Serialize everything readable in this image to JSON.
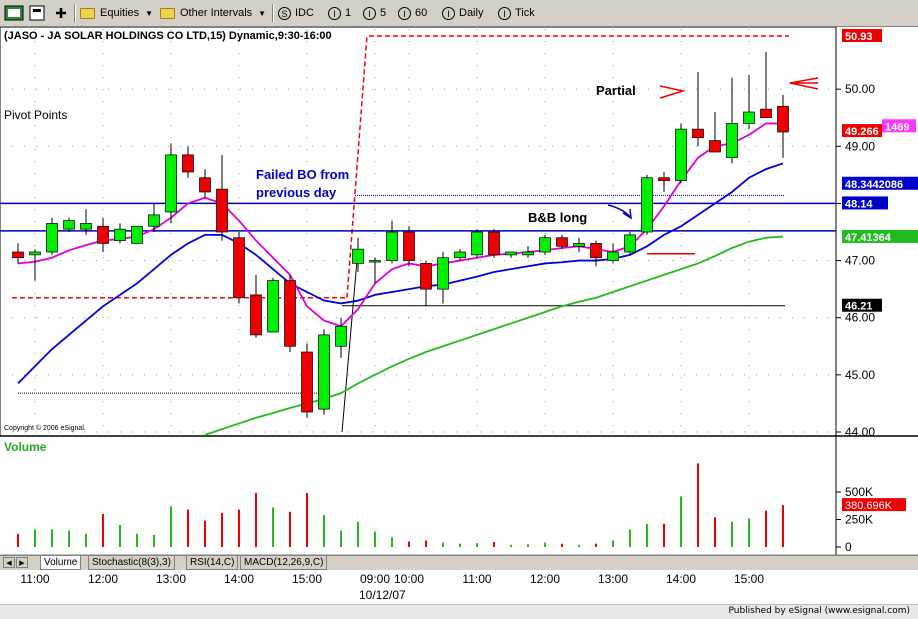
{
  "toolbar": {
    "equities_label": "Equities",
    "other_intervals_label": "Other Intervals",
    "idc_label": "IDC",
    "interval_1": "1",
    "interval_5": "5",
    "interval_60": "60",
    "daily_label": "Daily",
    "tick_label": "Tick",
    "idc_icon": "S",
    "interval_icon": "I"
  },
  "tabs": [
    "Volume",
    "Stochastic(8(3),3)",
    "RSI(14,C)",
    "MACD(12,26,9,C)"
  ],
  "footer": {
    "published": "Published by eSignal (www.esignal.com)"
  },
  "colors": {
    "up": "#00ee00",
    "down": "#ee0000",
    "ma_fast": "#dd00dd",
    "ma_mid": "#0000dd",
    "ma_slow": "#22bb22",
    "level": "#0000aa",
    "pivot": "#ff0000"
  },
  "chart_data": {
    "type": "candlestick",
    "title": "(JASO - JA SOLAR HOLDINGS CO LTD,15) Dynamic,9:30-16:00",
    "copyright": "Copyright © 2006 eSignal.",
    "pivot_label": "Pivot Points",
    "volume_label": "Volume",
    "date_label": "10/12/07",
    "ylim": [
      44.0,
      51.0
    ],
    "y_ticks": [
      44.0,
      45.0,
      46.0,
      47.0,
      48.0,
      49.0,
      50.0
    ],
    "volume_ticks": [
      {
        "label": "500K",
        "value": 500000
      },
      {
        "label": "250K",
        "value": 250000
      },
      {
        "label": "0",
        "value": 0
      }
    ],
    "volume_max": 800000,
    "x_labels": [
      {
        "label": "11:00",
        "bar": 1
      },
      {
        "label": "12:00",
        "bar": 5
      },
      {
        "label": "13:00",
        "bar": 9
      },
      {
        "label": "14:00",
        "bar": 13
      },
      {
        "label": "15:00",
        "bar": 17
      },
      {
        "label": "09:00",
        "bar": 21
      },
      {
        "label": "10:00",
        "bar": 23
      },
      {
        "label": "11:00",
        "bar": 27
      },
      {
        "label": "12:00",
        "bar": 31
      },
      {
        "label": "13:00",
        "bar": 35
      },
      {
        "label": "14:00",
        "bar": 39
      },
      {
        "label": "15:00",
        "bar": 43
      }
    ],
    "candles": [
      {
        "o": 47.15,
        "h": 47.3,
        "l": 46.95,
        "c": 47.05,
        "v": 120000
      },
      {
        "o": 47.1,
        "h": 47.2,
        "l": 46.65,
        "c": 47.15,
        "v": 160000
      },
      {
        "o": 47.15,
        "h": 47.75,
        "l": 47.1,
        "c": 47.65,
        "v": 160000
      },
      {
        "o": 47.55,
        "h": 47.75,
        "l": 47.5,
        "c": 47.7,
        "v": 150000
      },
      {
        "o": 47.55,
        "h": 47.9,
        "l": 47.45,
        "c": 47.65,
        "v": 120000
      },
      {
        "o": 47.6,
        "h": 47.75,
        "l": 47.15,
        "c": 47.3,
        "v": 300000
      },
      {
        "o": 47.35,
        "h": 47.65,
        "l": 47.3,
        "c": 47.55,
        "v": 200000
      },
      {
        "o": 47.3,
        "h": 47.6,
        "l": 47.3,
        "c": 47.6,
        "v": 120000
      },
      {
        "o": 47.6,
        "h": 48.0,
        "l": 47.5,
        "c": 47.8,
        "v": 110000
      },
      {
        "o": 47.85,
        "h": 49.05,
        "l": 47.65,
        "c": 48.85,
        "v": 370000
      },
      {
        "o": 48.85,
        "h": 49.0,
        "l": 48.45,
        "c": 48.55,
        "v": 340000
      },
      {
        "o": 48.45,
        "h": 48.6,
        "l": 48.1,
        "c": 48.2,
        "v": 240000
      },
      {
        "o": 48.25,
        "h": 48.85,
        "l": 47.35,
        "c": 47.5,
        "v": 310000
      },
      {
        "o": 47.4,
        "h": 47.5,
        "l": 46.25,
        "c": 46.35,
        "v": 340000
      },
      {
        "o": 46.4,
        "h": 46.75,
        "l": 45.65,
        "c": 45.7,
        "v": 490000
      },
      {
        "o": 45.75,
        "h": 46.7,
        "l": 45.75,
        "c": 46.65,
        "v": 360000
      },
      {
        "o": 46.65,
        "h": 46.75,
        "l": 45.4,
        "c": 45.5,
        "v": 320000
      },
      {
        "o": 45.4,
        "h": 45.55,
        "l": 44.25,
        "c": 44.35,
        "v": 490000
      },
      {
        "o": 44.4,
        "h": 45.8,
        "l": 44.3,
        "c": 45.7,
        "v": 290000
      },
      {
        "o": 45.5,
        "h": 46.0,
        "l": 45.3,
        "c": 45.85,
        "v": 150000
      },
      {
        "o": 46.95,
        "h": 47.4,
        "l": 46.8,
        "c": 47.2,
        "v": 230000
      },
      {
        "o": 47.0,
        "h": 47.05,
        "l": 46.6,
        "c": 47.0,
        "v": 140000
      },
      {
        "o": 47.0,
        "h": 47.7,
        "l": 46.95,
        "c": 47.5,
        "v": 90000
      },
      {
        "o": 47.5,
        "h": 47.6,
        "l": 46.9,
        "c": 47.0,
        "v": 50000
      },
      {
        "o": 46.95,
        "h": 47.0,
        "l": 46.2,
        "c": 46.5,
        "v": 60000
      },
      {
        "o": 46.5,
        "h": 47.15,
        "l": 46.25,
        "c": 47.05,
        "v": 40000
      },
      {
        "o": 47.05,
        "h": 47.2,
        "l": 47.0,
        "c": 47.15,
        "v": 30000
      },
      {
        "o": 47.1,
        "h": 47.55,
        "l": 47.05,
        "c": 47.5,
        "v": 35000
      },
      {
        "o": 47.5,
        "h": 47.55,
        "l": 47.05,
        "c": 47.1,
        "v": 45000
      },
      {
        "o": 47.1,
        "h": 47.15,
        "l": 47.05,
        "c": 47.15,
        "v": 20000
      },
      {
        "o": 47.1,
        "h": 47.25,
        "l": 47.05,
        "c": 47.15,
        "v": 25000
      },
      {
        "o": 47.15,
        "h": 47.45,
        "l": 47.1,
        "c": 47.4,
        "v": 40000
      },
      {
        "o": 47.4,
        "h": 47.45,
        "l": 47.2,
        "c": 47.25,
        "v": 30000
      },
      {
        "o": 47.25,
        "h": 47.4,
        "l": 47.15,
        "c": 47.3,
        "v": 20000
      },
      {
        "o": 47.3,
        "h": 47.35,
        "l": 46.9,
        "c": 47.05,
        "v": 30000
      },
      {
        "o": 47.0,
        "h": 47.3,
        "l": 46.95,
        "c": 47.15,
        "v": 60000
      },
      {
        "o": 47.15,
        "h": 47.5,
        "l": 47.1,
        "c": 47.45,
        "v": 160000
      },
      {
        "o": 47.5,
        "h": 48.5,
        "l": 47.45,
        "c": 48.45,
        "v": 210000
      },
      {
        "o": 48.45,
        "h": 48.55,
        "l": 48.2,
        "c": 48.4,
        "v": 210000
      },
      {
        "o": 48.4,
        "h": 49.4,
        "l": 48.35,
        "c": 49.3,
        "v": 460000
      },
      {
        "o": 49.3,
        "h": 50.3,
        "l": 49.0,
        "c": 49.15,
        "v": 760000
      },
      {
        "o": 49.1,
        "h": 49.6,
        "l": 48.95,
        "c": 48.9,
        "v": 270000
      },
      {
        "o": 48.8,
        "h": 50.2,
        "l": 48.7,
        "c": 49.4,
        "v": 230000
      },
      {
        "o": 49.4,
        "h": 50.25,
        "l": 49.3,
        "c": 49.6,
        "v": 260000
      },
      {
        "o": 49.65,
        "h": 50.65,
        "l": 49.5,
        "c": 49.5,
        "v": 330000
      },
      {
        "o": 49.7,
        "h": 49.9,
        "l": 48.8,
        "c": 49.25,
        "v": 380696
      }
    ],
    "ma_fast": [
      46.95,
      46.98,
      47.05,
      47.18,
      47.27,
      47.35,
      47.38,
      47.42,
      47.55,
      47.75,
      48.0,
      48.1,
      48.0,
      47.7,
      47.35,
      47.05,
      46.75,
      46.2,
      45.95,
      45.85,
      46.15,
      46.6,
      46.85,
      46.95,
      46.9,
      46.95,
      47.0,
      47.05,
      47.1,
      47.12,
      47.15,
      47.18,
      47.22,
      47.25,
      47.2,
      47.15,
      47.25,
      47.55,
      47.95,
      48.4,
      48.8,
      49.0,
      49.05,
      49.2,
      49.4,
      49.4
    ],
    "ma_mid": [
      44.85,
      45.15,
      45.45,
      45.7,
      45.95,
      46.2,
      46.4,
      46.6,
      46.85,
      47.1,
      47.3,
      47.45,
      47.45,
      47.3,
      47.1,
      46.85,
      46.6,
      46.45,
      46.3,
      46.25,
      46.3,
      46.4,
      46.45,
      46.5,
      46.55,
      46.58,
      46.65,
      46.72,
      46.8,
      46.85,
      46.9,
      46.95,
      46.97,
      47.0,
      47.0,
      47.03,
      47.1,
      47.25,
      47.45,
      47.6,
      47.8,
      48.0,
      48.2,
      48.45,
      48.6,
      48.7
    ],
    "ma_slow_start": 11,
    "ma_slow": [
      43.95,
      44.05,
      44.15,
      44.25,
      44.33,
      44.42,
      44.5,
      44.58,
      44.68,
      44.85,
      45.0,
      45.15,
      45.28,
      45.4,
      45.5,
      45.6,
      45.7,
      45.8,
      45.9,
      46.0,
      46.1,
      46.2,
      46.28,
      46.35,
      46.45,
      46.55,
      46.65,
      46.75,
      46.85,
      46.95,
      47.08,
      47.22,
      47.33,
      47.4,
      47.42
    ],
    "levels": [
      {
        "label": "48.14",
        "value": 48.0,
        "type": "solid"
      },
      {
        "label": "47.41364",
        "value": 47.41364,
        "type": "solid"
      },
      {
        "label": "46.21",
        "value": 46.21,
        "type": "thin"
      },
      {
        "label": "48.3442086",
        "value": 48.3442086,
        "type": "ma"
      }
    ],
    "pivots": [
      {
        "value": 46.35,
        "from_bar": 0,
        "to_bar": 19
      },
      {
        "value": 50.93,
        "from_bar": 21,
        "to_bar": 45
      }
    ],
    "price_labels": [
      {
        "label": "50.93",
        "value": 50.93,
        "style": "red"
      },
      {
        "label": "49.266",
        "value": 49.266,
        "style": "red"
      },
      {
        "label": "1469",
        "value": 49.35,
        "style": "magenta"
      },
      {
        "label": "48.14",
        "value": 48.0,
        "style": "blue-small"
      },
      {
        "label": "48.3442086",
        "value": 48.3442086,
        "style": "blue"
      },
      {
        "label": "47.41364",
        "value": 47.41364,
        "style": "green"
      },
      {
        "label": "46.21",
        "value": 46.21,
        "style": "black"
      }
    ],
    "volume_last_label": "380.696K",
    "annotations": [
      {
        "text": "Failed BO from",
        "line2": "previous day"
      },
      {
        "text": "B&B long"
      },
      {
        "text": "Partial"
      }
    ]
  }
}
